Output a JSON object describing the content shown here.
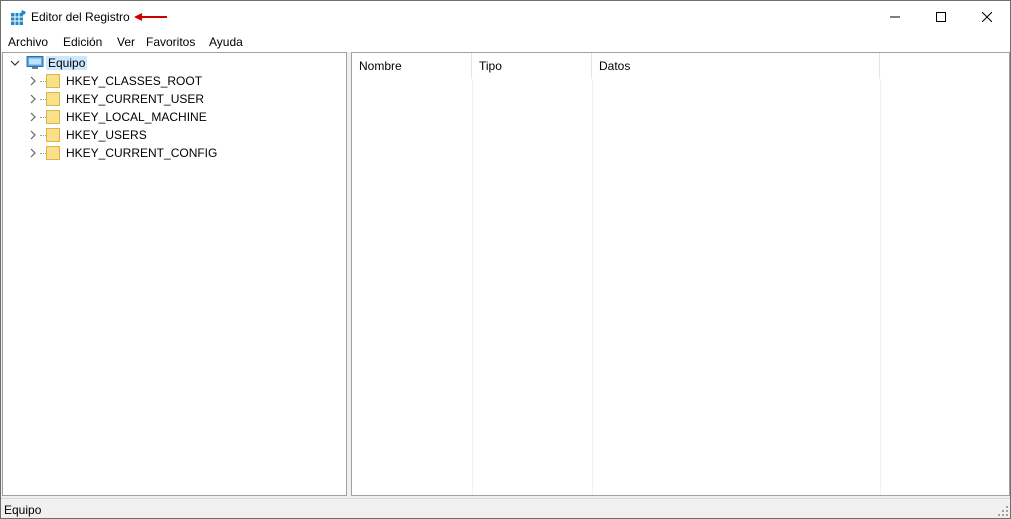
{
  "window": {
    "title": "Editor del Registro",
    "accent_color": "#cc0000"
  },
  "menu": {
    "items": [
      "Archivo",
      "Edición",
      "Ver",
      "Favoritos",
      "Ayuda"
    ]
  },
  "tree": {
    "root": {
      "label": "Equipo",
      "expanded": true,
      "selected": true,
      "icon": "computer-icon"
    },
    "children": [
      {
        "label": "HKEY_CLASSES_ROOT",
        "icon": "folder-icon",
        "expanded": false
      },
      {
        "label": "HKEY_CURRENT_USER",
        "icon": "folder-icon",
        "expanded": false
      },
      {
        "label": "HKEY_LOCAL_MACHINE",
        "icon": "folder-icon",
        "expanded": false
      },
      {
        "label": "HKEY_USERS",
        "icon": "folder-icon",
        "expanded": false
      },
      {
        "label": "HKEY_CURRENT_CONFIG",
        "icon": "folder-icon",
        "expanded": false
      }
    ]
  },
  "list": {
    "columns": [
      "Nombre",
      "Tipo",
      "Datos"
    ],
    "rows": []
  },
  "statusbar": {
    "text": "Equipo"
  },
  "colors": {
    "selection": "#cce8ff",
    "folder": "#fbe08a",
    "annotation_arrow": "#cc0000"
  }
}
